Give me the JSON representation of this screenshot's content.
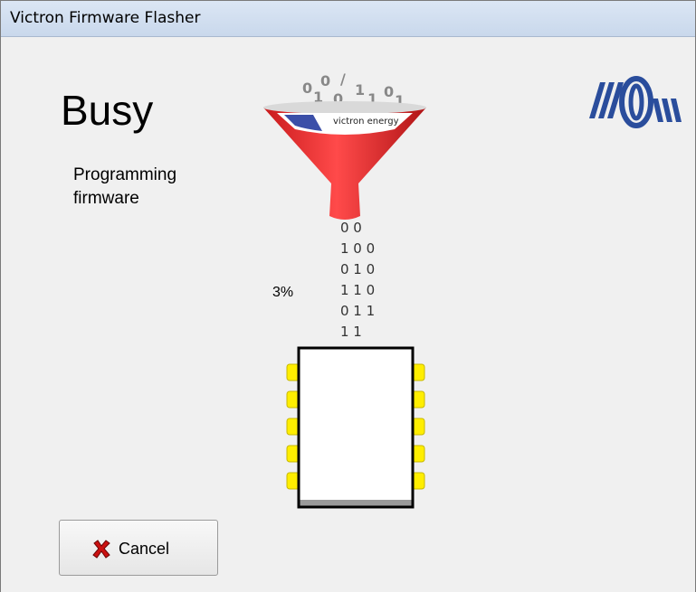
{
  "window": {
    "title": "Victron Firmware Flasher"
  },
  "status": {
    "heading": "Busy",
    "description_line1": "Programming",
    "description_line2": "firmware",
    "progress_label": "3%",
    "progress_percent": 3
  },
  "animation": {
    "bits": [
      "0 0",
      "1 0 0",
      "0 1 0",
      "1 1 0",
      "0 1 1",
      "1 1"
    ],
    "funnel_text": "victron energy"
  },
  "buttons": {
    "cancel_label": "Cancel"
  },
  "icons": {
    "cancel": "x-red-icon",
    "logo": "victron-logo-icon"
  },
  "colors": {
    "funnel": "#e8282a",
    "logo": "#2a4d9c",
    "pins": "#ffee00",
    "cancel_icon": "#cc1111"
  }
}
